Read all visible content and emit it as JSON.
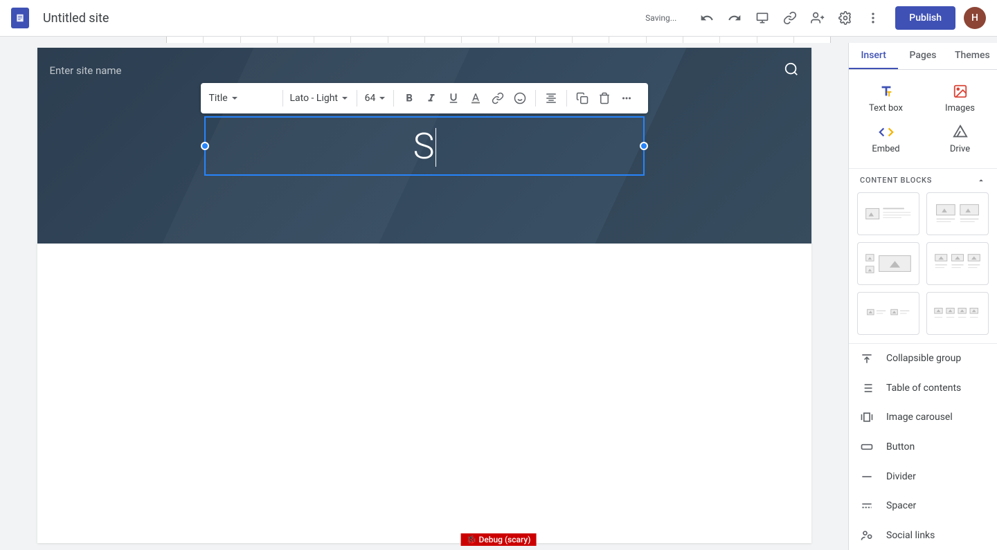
{
  "header": {
    "doc_title": "Untitled site",
    "saving_status": "Saving...",
    "publish_label": "Publish",
    "avatar_initial": "H"
  },
  "canvas": {
    "site_name_placeholder": "Enter site name",
    "title_text": "S"
  },
  "toolbar": {
    "style_select": "Title",
    "font_select": "Lato - Light",
    "font_size": "64"
  },
  "sidebar": {
    "tabs": [
      "Insert",
      "Pages",
      "Themes"
    ],
    "insert_items": {
      "textbox": "Text box",
      "images": "Images",
      "embed": "Embed",
      "drive": "Drive"
    },
    "content_blocks_header": "CONTENT BLOCKS",
    "items": {
      "collapsible": "Collapsible group",
      "toc": "Table of contents",
      "carousel": "Image carousel",
      "button": "Button",
      "divider": "Divider",
      "spacer": "Spacer",
      "social": "Social links"
    }
  },
  "debug_label": "🐞 Debug (scary)"
}
